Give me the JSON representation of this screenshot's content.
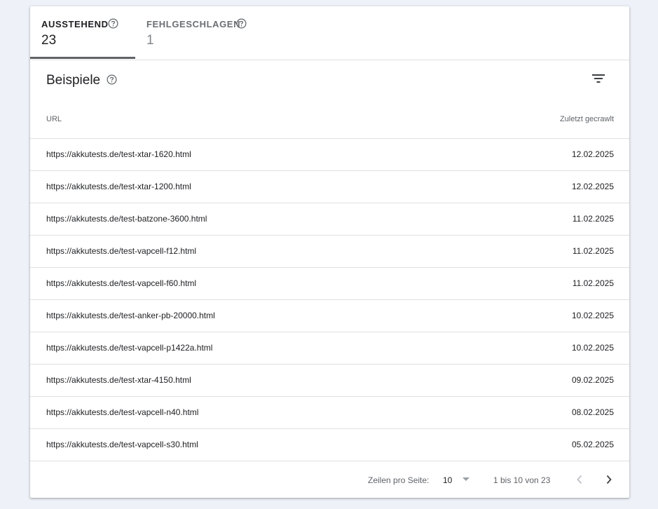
{
  "tabs": [
    {
      "label": "AUSSTEHEND",
      "count": "23",
      "active": true
    },
    {
      "label": "FEHLGESCHLAGEN",
      "count": "1",
      "active": false
    }
  ],
  "section": {
    "title": "Beispiele"
  },
  "table": {
    "headers": {
      "url": "URL",
      "date": "Zuletzt gecrawlt"
    },
    "rows": [
      {
        "url": "https://akkutests.de/test-xtar-1620.html",
        "date": "12.02.2025"
      },
      {
        "url": "https://akkutests.de/test-xtar-1200.html",
        "date": "12.02.2025"
      },
      {
        "url": "https://akkutests.de/test-batzone-3600.html",
        "date": "11.02.2025"
      },
      {
        "url": "https://akkutests.de/test-vapcell-f12.html",
        "date": "11.02.2025"
      },
      {
        "url": "https://akkutests.de/test-vapcell-f60.html",
        "date": "11.02.2025"
      },
      {
        "url": "https://akkutests.de/test-anker-pb-20000.html",
        "date": "10.02.2025"
      },
      {
        "url": "https://akkutests.de/test-vapcell-p1422a.html",
        "date": "10.02.2025"
      },
      {
        "url": "https://akkutests.de/test-xtar-4150.html",
        "date": "09.02.2025"
      },
      {
        "url": "https://akkutests.de/test-vapcell-n40.html",
        "date": "08.02.2025"
      },
      {
        "url": "https://akkutests.de/test-vapcell-s30.html",
        "date": "05.02.2025"
      }
    ]
  },
  "pagination": {
    "rows_per_page_label": "Zeilen pro Seite:",
    "rows_per_page_value": "10",
    "range": "1 bis 10 von 23"
  },
  "icons": {
    "help": "help-circle-icon",
    "filter": "filter-icon",
    "prev": "chevron-left-icon",
    "next": "chevron-right-icon",
    "dropdown": "caret-down-icon"
  }
}
